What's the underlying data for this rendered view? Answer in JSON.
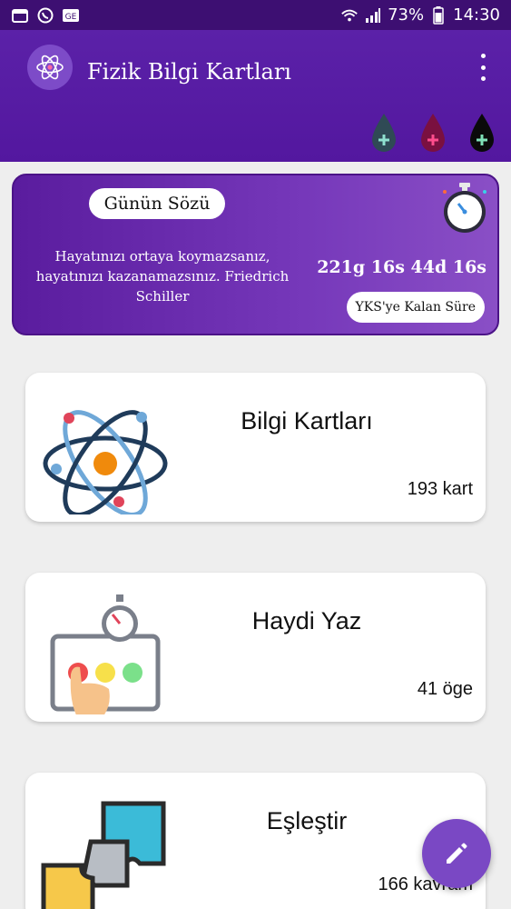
{
  "status_bar": {
    "battery": "73%",
    "time": "14:30",
    "icons": [
      "calendar-icon",
      "whatsapp-icon",
      "ge-icon",
      "wifi-icon",
      "signal-icon",
      "battery-icon"
    ]
  },
  "app_bar": {
    "title": "Fizik Bilgi Kartları",
    "logo_icon": "atom-icon",
    "menu_icon": "more-vert-icon",
    "drops": [
      {
        "name": "dark-teal-drop",
        "color": "#2f4a55"
      },
      {
        "name": "crimson-drop",
        "color": "#7a1040"
      },
      {
        "name": "black-drop",
        "color": "#0a0a0a"
      }
    ]
  },
  "quote_card": {
    "pill_label": "Günün Sözü",
    "quote": "Hayatınızı ortaya koymazsanız, hayatınızı kazanamazsınız. Friedrich Schiller",
    "countdown": "221g 16s 44d 16s",
    "countdown_label": "YKS'ye Kalan Süre"
  },
  "cards": [
    {
      "title": "Bilgi Kartları",
      "count": "193 kart",
      "icon": "atom-icon"
    },
    {
      "title": "Haydi Yaz",
      "count": "41 öge",
      "icon": "stopwatch-board-icon"
    },
    {
      "title": "Eşleştir",
      "count": "166 kavram",
      "icon": "puzzle-icon"
    }
  ],
  "fab": {
    "icon": "edit-pencil-icon"
  }
}
